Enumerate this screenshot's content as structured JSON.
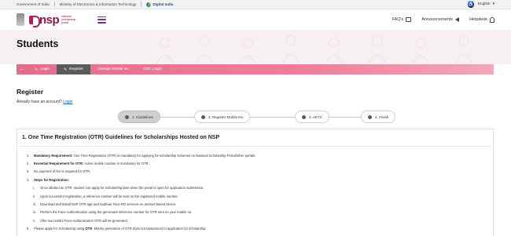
{
  "gov_strip": {
    "gov_india": "Government of India",
    "ministry": "Ministry of Electronics & Information Technology",
    "badge": "Digital India",
    "language": "English"
  },
  "header": {
    "logo_text": "nsp",
    "logo_sub": "national scholarship portal",
    "faqs": "FAQ's",
    "announcements": "Announcements",
    "helpdesk": "Helpdesk"
  },
  "hero": {
    "title": "Students"
  },
  "nav": {
    "items": [
      {
        "label": "Login"
      },
      {
        "label": "Register"
      },
      {
        "label": "Change Mobile no."
      },
      {
        "label": "CSC Login"
      }
    ]
  },
  "register": {
    "title": "Register",
    "prompt": "Already have an account?",
    "login_link": "Login"
  },
  "stepper": {
    "steps": [
      {
        "label": "1. Guidelines"
      },
      {
        "label": "2. Register Mobile No"
      },
      {
        "label": "3. eKYC"
      },
      {
        "label": "4. Finish"
      }
    ]
  },
  "guidelines": {
    "heading": "1. One Time Registration (OTR) Guidelines for Scholarships Hosted on NSP",
    "items": [
      {
        "num": "1.",
        "bold": "Mandatory Requirement:",
        "text": " One Time Registration (OTR) is mandatory for applying for scholarship schemes on National Scholarship Portal/other portals."
      },
      {
        "num": "2.",
        "bold": "Essential Requirement for OTR:",
        "text": " Active mobile number is mandatory for OTR."
      },
      {
        "num": "3.",
        "bold": "",
        "text": "No payment of fee is required for OTR."
      },
      {
        "num": "4.",
        "bold": "Steps for Registration:",
        "text": ""
      }
    ],
    "sub_items": [
      {
        "num": "i.",
        "text": "Once allotted an OTR, student can apply for scholarship later when the portal is open for application submission."
      },
      {
        "num": "ii.",
        "text": "Upon successful registration, a reference number will be sent on the registered mobile number."
      },
      {
        "num": "iii.",
        "text": "Download and install NSP OTR app and Aadhaar Face RD services on android based device."
      },
      {
        "num": "iv.",
        "text": "Perform the Face-Authentication using the generated reference number for OTR sent on your mobile no."
      },
      {
        "num": "v.",
        "text": "After successful Face-Authentication OTR will be generated."
      }
    ],
    "item5": {
      "num": "5.",
      "text": "Please apply for Scholarship using ",
      "bold": "OTR",
      "text2": ". Merely generation of OTR does not tantamount to application for scholarship."
    }
  }
}
